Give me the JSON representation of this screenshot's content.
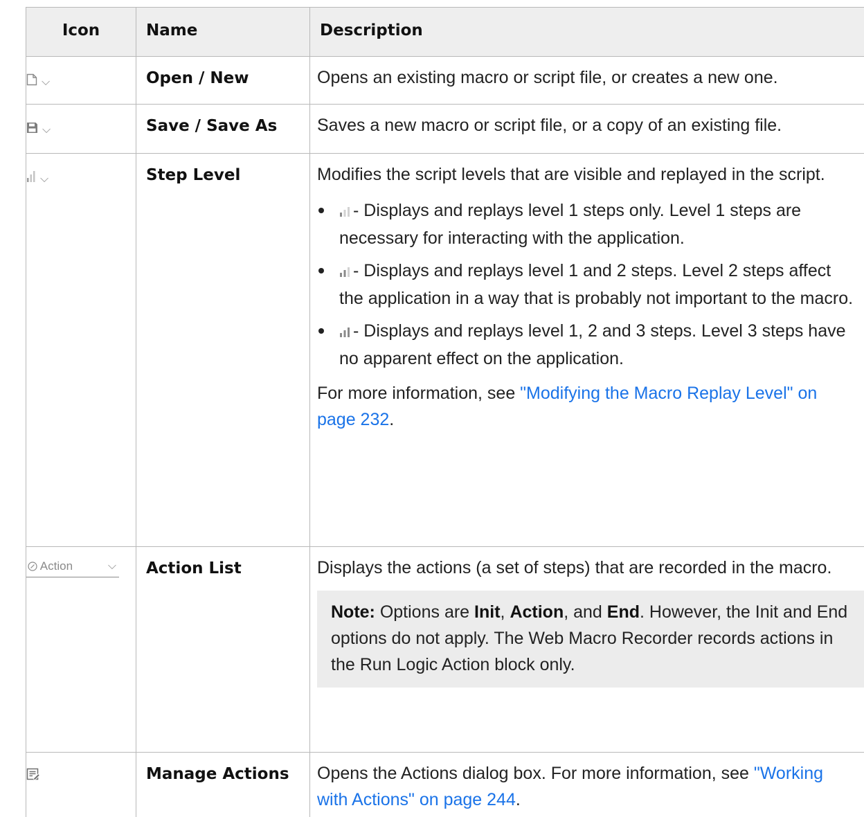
{
  "headers": {
    "icon": "Icon",
    "name": "Name",
    "description": "Description"
  },
  "rows": [
    {
      "icon": "new-file-icon",
      "name": "Open / New",
      "description": "Opens an existing macro or script file, or creates a new one."
    },
    {
      "icon": "save-icon",
      "name": "Save / Save As",
      "description": "Saves a new macro or script file, or a copy of an existing file."
    },
    {
      "icon": "step-level-icon",
      "name": "Step Level",
      "description": "Modifies the script levels that are visible and replayed in the script.",
      "levels": [
        "- Displays and replays level 1 steps only. Level 1 steps are necessary for interacting with the application.",
        "- Displays and replays level 1 and 2 steps. Level 2 steps affect the application in a way that is probably not important to the macro.",
        "- Displays and replays level 1, 2 and 3 steps. Level 3 steps have no apparent effect on the application."
      ],
      "more_prefix": "For more information, see ",
      "more_link": "\"Modifying the Macro Replay Level\" on page 232",
      "more_suffix": "."
    },
    {
      "icon": "action-list-combo",
      "icon_label": "Action",
      "name": "Action List",
      "description": "Displays the actions (a set of steps) that are recorded in the macro.",
      "note": {
        "label": "Note:",
        "t1": " Options are ",
        "init": "Init",
        "t2": ", ",
        "action": "Action",
        "t3": ", and ",
        "end": "End",
        "t4": ". However, the Init and End options do not apply. The Web Macro Recorder records actions in the Run Logic Action block only."
      }
    },
    {
      "icon": "manage-actions-icon",
      "name": "Manage Actions",
      "description": "Opens the Actions dialog box. For more information, see ",
      "link": "\"Working with Actions\" on page 244",
      "suffix": "."
    }
  ],
  "colors": {
    "link": "#1a73e8",
    "header_bg": "#eeeeee",
    "note_bg": "#ececec",
    "icon_gray": "#8a8a8a"
  }
}
